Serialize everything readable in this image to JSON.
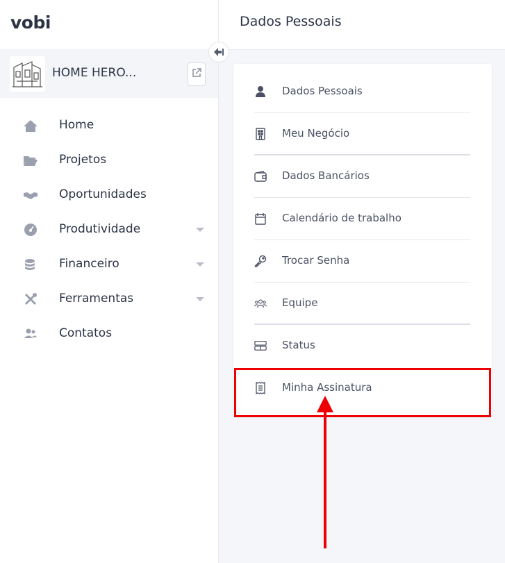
{
  "app": {
    "logo": "vobi"
  },
  "company": {
    "name": "HOME HERO..."
  },
  "nav": [
    {
      "label": "Home",
      "icon": "home-icon",
      "dropdown": false
    },
    {
      "label": "Projetos",
      "icon": "folder-icon",
      "dropdown": false
    },
    {
      "label": "Oportunidades",
      "icon": "handshake-icon",
      "dropdown": false
    },
    {
      "label": "Produtividade",
      "icon": "gauge-icon",
      "dropdown": true
    },
    {
      "label": "Financeiro",
      "icon": "coins-icon",
      "dropdown": true
    },
    {
      "label": "Ferramentas",
      "icon": "tools-icon",
      "dropdown": true
    },
    {
      "label": "Contatos",
      "icon": "contacts-icon",
      "dropdown": false
    }
  ],
  "header": {
    "title": "Dados Pessoais"
  },
  "settings_menu": [
    {
      "label": "Dados Pessoais",
      "icon": "user-icon"
    },
    {
      "label": "Meu Negócio",
      "icon": "building-icon"
    },
    {
      "label": "Dados Bancários",
      "icon": "wallet-icon"
    },
    {
      "label": "Calendário de trabalho",
      "icon": "calendar-icon"
    },
    {
      "label": "Trocar Senha",
      "icon": "key-icon"
    },
    {
      "label": "Equipe",
      "icon": "team-icon"
    },
    {
      "label": "Status",
      "icon": "status-icon"
    },
    {
      "label": "Minha Assinatura",
      "icon": "receipt-icon"
    }
  ],
  "colors": {
    "accent_red": "#ee0000",
    "text": "#2c3345",
    "icon_gray": "#9aa0ad"
  }
}
